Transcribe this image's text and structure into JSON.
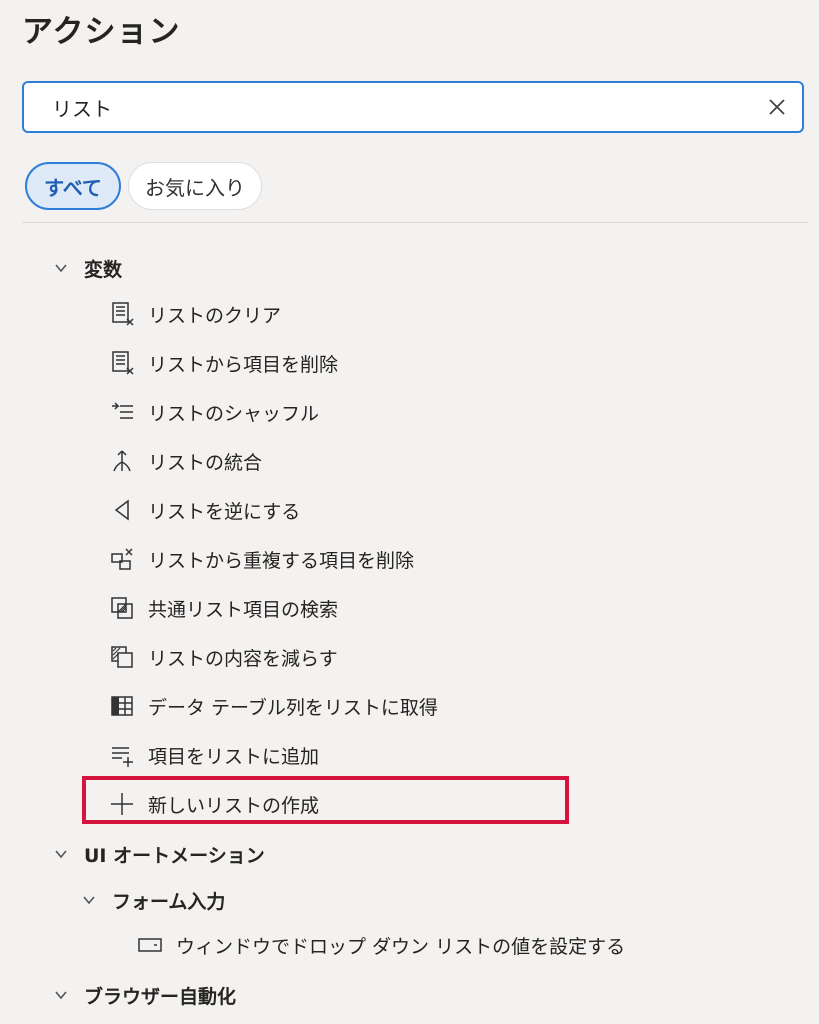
{
  "panel": {
    "title": "アクション"
  },
  "search": {
    "value": "リスト",
    "placeholder": ""
  },
  "filters": {
    "all_label": "すべて",
    "favorites_label": "お気に入り"
  },
  "groups": {
    "variables": {
      "label": "変数",
      "items": [
        {
          "label": "リストのクリア",
          "icon": "list-clear-icon"
        },
        {
          "label": "リストから項目を削除",
          "icon": "list-remove-item-icon"
        },
        {
          "label": "リストのシャッフル",
          "icon": "shuffle-list-icon"
        },
        {
          "label": "リストの統合",
          "icon": "merge-lists-icon"
        },
        {
          "label": "リストを逆にする",
          "icon": "reverse-list-icon"
        },
        {
          "label": "リストから重複する項目を削除",
          "icon": "remove-duplicates-icon"
        },
        {
          "label": "共通リスト項目の検索",
          "icon": "find-common-items-icon"
        },
        {
          "label": "リストの内容を減らす",
          "icon": "subtract-lists-icon"
        },
        {
          "label": "データ テーブル列をリストに取得",
          "icon": "datatable-column-icon"
        },
        {
          "label": "項目をリストに追加",
          "icon": "add-item-icon"
        },
        {
          "label": "新しいリストの作成",
          "icon": "plus-icon"
        }
      ]
    },
    "ui_automation": {
      "label": "UI オートメーション",
      "subgroup": {
        "label": "フォーム入力",
        "items": [
          {
            "label": "ウィンドウでドロップ ダウン リストの値を設定する",
            "icon": "dropdown-field-icon"
          }
        ]
      }
    },
    "browser_automation": {
      "label": "ブラウザー自動化"
    }
  },
  "colors": {
    "accent": "#2f7ed8",
    "highlight": "#d4143c",
    "background": "#f3f2f1"
  }
}
